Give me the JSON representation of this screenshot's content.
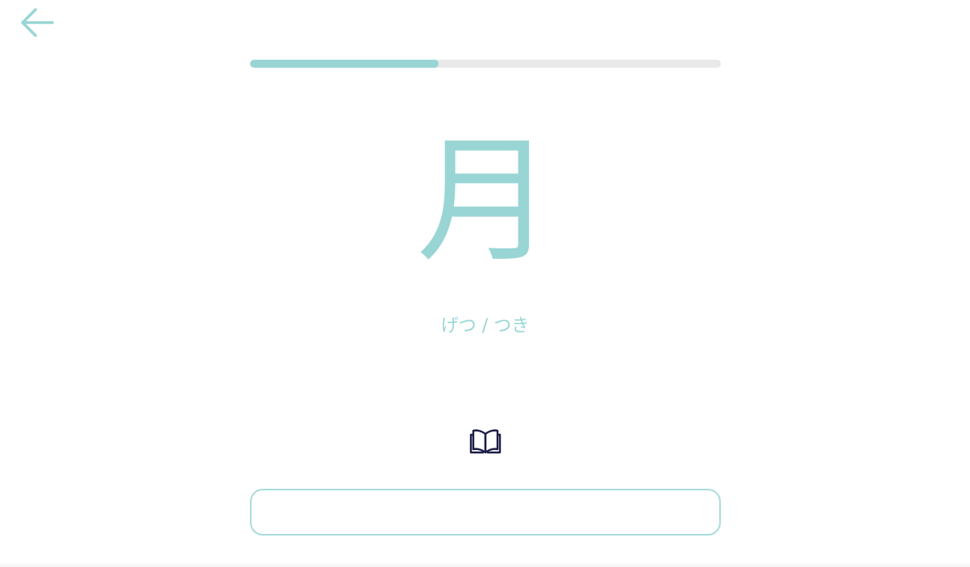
{
  "app": {
    "accent_color": "#99d5d5",
    "icon_dark_color": "#1b1d45"
  },
  "nav": {
    "back_icon": "arrow-left-icon"
  },
  "progress": {
    "fraction": 0.4
  },
  "card": {
    "kanji": "月",
    "reading": "げつ / つき"
  },
  "reference": {
    "icon": "open-book-icon"
  },
  "answer": {
    "value": "",
    "placeholder": ""
  }
}
